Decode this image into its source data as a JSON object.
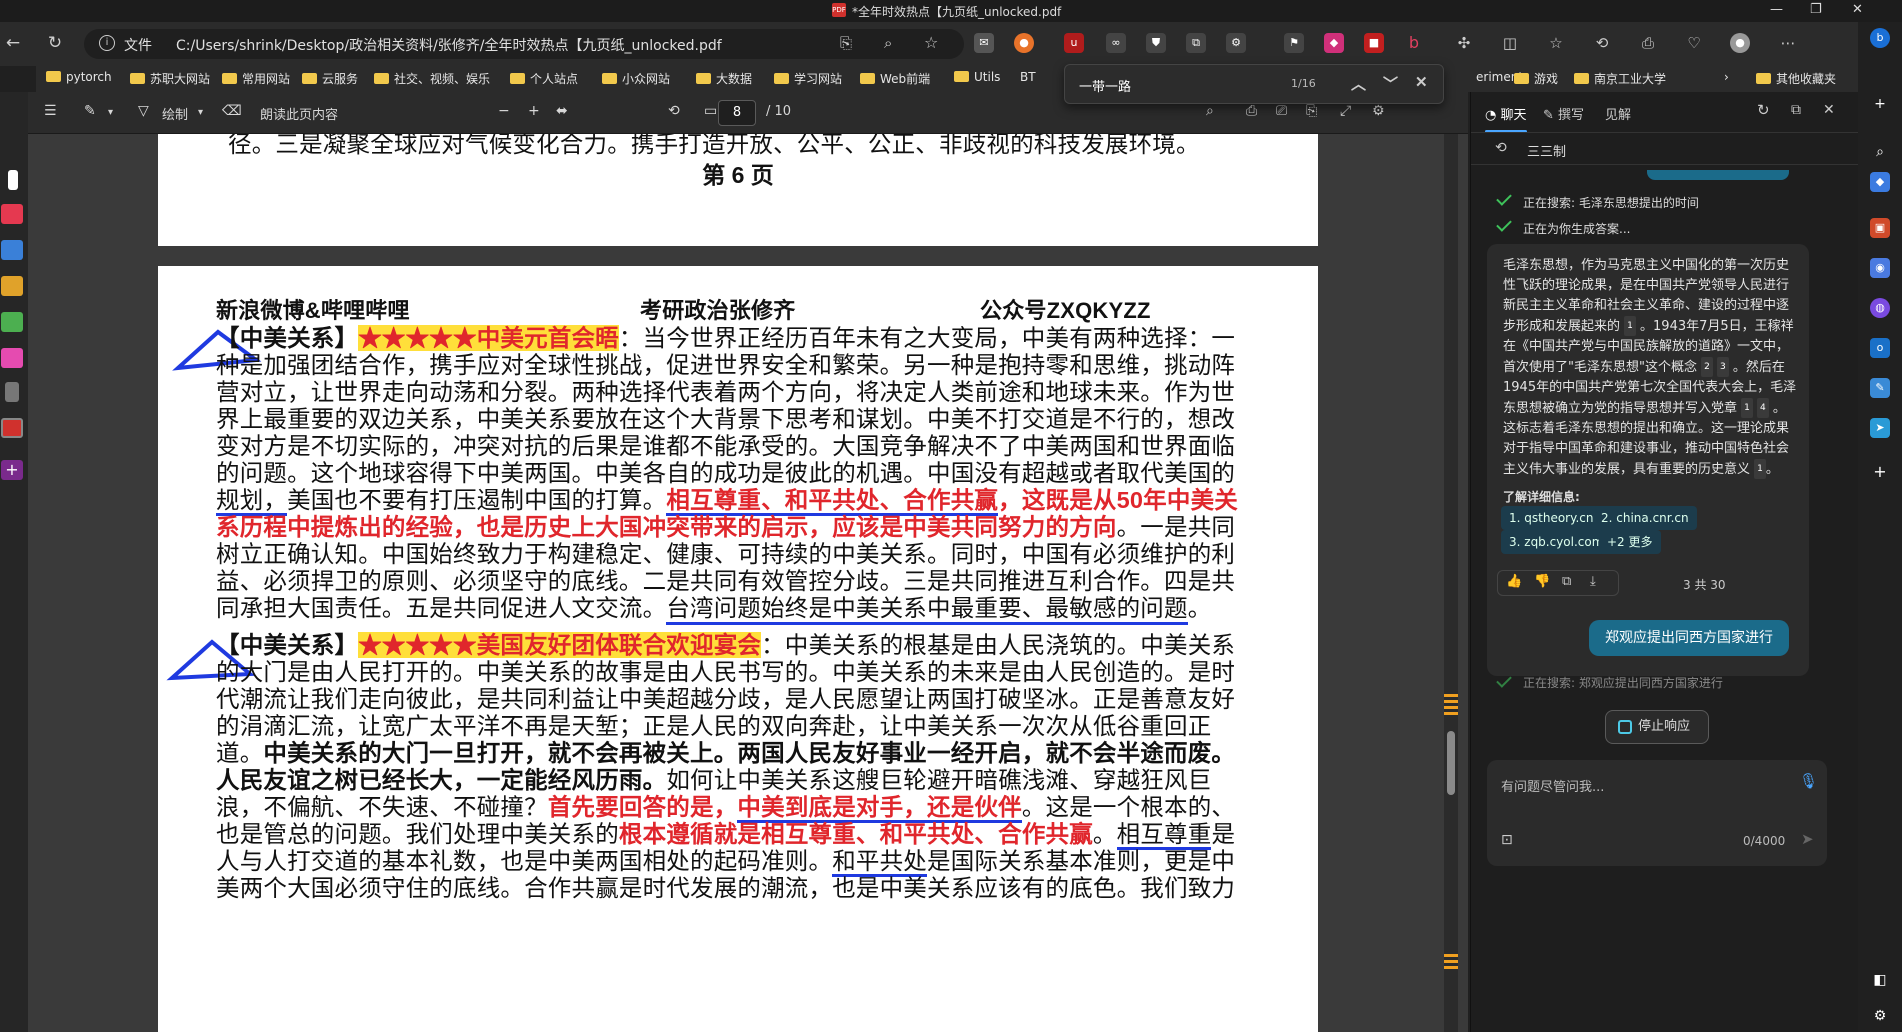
{
  "window": {
    "title": "*全年时效热点【九页纸_unlocked.pdf",
    "pdf_badge": "PDF"
  },
  "navbar": {
    "file_label": "文件",
    "url": "C:/Users/shrink/Desktop/政治相关资料/张修齐/全年时效热点【九页纸_unlocked.pdf"
  },
  "bookmarks": {
    "items": [
      "pytorch",
      "苏职大网站",
      "常用网站",
      "云服务",
      "社交、视频、娱乐",
      "个人站点",
      "小众网站",
      "大数据",
      "学习网站",
      "Web前端",
      "Utils",
      "BT",
      "eriments",
      "游戏",
      "南京工业大学",
      "其他收藏夹"
    ]
  },
  "find": {
    "query": "一带一路",
    "count": "1/16"
  },
  "pdf_toolbar": {
    "draw_label": "绘制",
    "read_aloud": "朗读此页内容",
    "page": "8",
    "total": "/ 10"
  },
  "page6": {
    "line1": "径。三是凝聚全球应对气候变化合力。携手打造开放、公平、公正、非歧视的科技发展环境。",
    "footer": "第 6 页"
  },
  "page7": {
    "header_left": "新浪微博&哔哩哔哩",
    "header_center": "考研政治张修齐",
    "header_right": "公众号ZXQKYZZ",
    "s1_tag": "【中美关系】",
    "s1_stars": "★★★★★中美元首会晤",
    "s1_l1": "：当今世界正经历百年未有之大变局，中美有两种选择：一",
    "s1_l2": "种是加强团结合作，携手应对全球性挑战，促进世界安全和繁荣。另一种是抱持零和思维，挑动阵",
    "s1_l3a": "营对立，让世界走向动荡和分裂。",
    "s1_l3b": "两种选择代表着两个方向，将决定人类前途和地球未来。作为世",
    "s1_l4": "界上最重要的双边关系，中美关系要放在这个大背景下思考和谋划。中美不打交道是不行的，想改",
    "s1_l5": "变对方是不切实际的，冲突对抗的后果是谁都不能承受的。大国竞争解决不了中美两国和世界面临",
    "s1_l6a": "的问题。这个地球容得下中美两国。中美各自的成功是彼此的机遇。",
    "s1_l6b": "中国没有超越或者取代美国的",
    "s1_l7a": "规划，",
    "s1_l7b": "美国也不要有打压遏制中国的打算。",
    "s1_l7c": "相互尊重、和平共处、合作共赢",
    "s1_l7d": "，这既是从50年中美关",
    "s1_l8a": "系历程中提炼出的经验，也是历史上大国冲突带来的启示，应该是中美共同努力的方向",
    "s1_l8b": "。一是共同",
    "s1_l9a": "树立正确认知。",
    "s1_l9b": "中国始终致力于构建稳定、健康、可持续的中美关系。同时，中国有必须维护的利",
    "s1_l10a": "益、必须捍卫的原则、必须坚守的底线。",
    "s1_l10b": "二是共同有效管控分歧。三是共同推进互利合作。四是共",
    "s1_l11a": "同承担大国责任。五是共同促进人文交流。",
    "s1_l11b": "台湾问题始终是中美关系中最重要、最敏感的问题",
    "s1_l11c": "。",
    "s2_tag": "【中美关系】",
    "s2_stars": "★★★★★美国友好团体联合欢迎宴会",
    "s2_l1": "：中美关系的根基是由人民浇筑的。中美关系",
    "s2_l2a": "的大门是由人民打开的。中美关系的故事是由人民书写的。中美关系的未来是由人民创造的。",
    "s2_l2b": "是时",
    "s2_l3": "代潮流让我们走向彼此，是共同利益让中美超越分歧，是人民愿望让两国打破坚冰。正是善意友好",
    "s2_l4": "的涓滴汇流，让宽广太平洋不再是天堑；正是人民的双向奔赴，让中美关系一次次从低谷重回正",
    "s2_l5a": "道。",
    "s2_l5b": "中美关系的大门一旦打开，就不会再被关上。两国人民友好事业一经开启，就不会半途而废。",
    "s2_l6a": "人民友谊之树已经长大，一定能经风历雨。",
    "s2_l6b": "如何让中美关系这艘巨轮避开暗礁浅滩、穿越狂风巨",
    "s2_l7a": "浪，不偏航、不失速、不碰撞？",
    "s2_l7b": "首先要回答的是，",
    "s2_l7c": "中美到底是对手，还是伙伴",
    "s2_l7d": "。这是一个根本的、",
    "s2_l8a": "也是管总的问题。",
    "s2_l8b": "我们处理中美关系的",
    "s2_l8c": "根本遵循就是相互尊重、和平共处、合作共赢",
    "s2_l8d": "。",
    "s2_l8e": "相互尊重",
    "s2_l8f": "是",
    "s2_l9a": "人与人打交道的基本礼数，也是中美两国相处的起码准则。",
    "s2_l9b": "和平共处",
    "s2_l9c": "是国际关系基本准则，更是中",
    "s2_l10": "美两个大国必须守住的底线。合作共赢是时代发展的潮流，也是中美关系应该有的底色。我们致力"
  },
  "copilot": {
    "tabs": [
      "聊天",
      "撰写",
      "见解"
    ],
    "mode": "三三制",
    "searching1": "正在搜索: 毛泽东思想提出的时间",
    "generating": "正在为你生成答案...",
    "answer_p1": "毛泽东思想，作为马克思主义中国化的第一次历史性飞跃的理论成果，是在中国共产党领导人民进行新民主主义革命和社会主义革命、建设的过程中逐步形成和发展起来的",
    "answer_p2": "。1943年7月5日，王稼祥在《中国共产党与中国民族解放的道路》一文中，首次使用了\"毛泽东思想\"这个概念",
    "answer_p3": "。然后在1945年的中国共产党第七次全国代表大会上，毛泽东思想被确立为党的指导思想并写入党章",
    "answer_p4": "。这标志着毛泽东思想的提出和确立。这一理论成果对于指导中国革命和建设事业，推动中国特色社会主义伟大事业的发展，具有重要的历史意义",
    "answer_p5": "。",
    "refs": [
      "1",
      "2",
      "3",
      "1",
      "4",
      "1"
    ],
    "learn_more": "了解详细信息:",
    "sources": [
      "1. qstheory.cn",
      "2. china.cnr.cn",
      "3. zqb.cyol.com",
      "+2 更多"
    ],
    "turns": "3 共 30",
    "user_msg": "郑观应提出同西方国家进行",
    "searching2": "正在搜索: 郑观应提出同西方国家进行",
    "stop": "停止响应",
    "input_placeholder": "有问题尽管问我...",
    "counter": "0/4000"
  }
}
